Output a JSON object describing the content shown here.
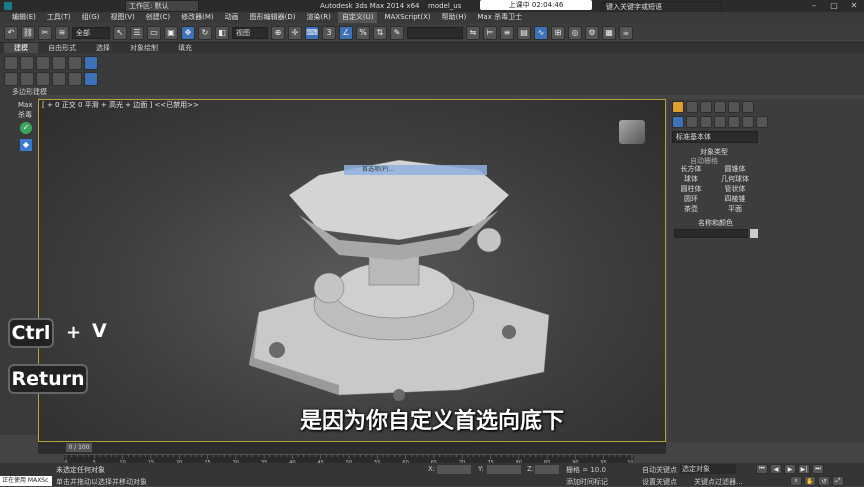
{
  "titlebar": {
    "workspace": "工作区: 默认",
    "title": "Autodesk 3ds Max  2014 x64",
    "file": "model_us",
    "search_placeholder": "键入关键字或短语",
    "controls": [
      "–",
      "▢",
      "✕"
    ]
  },
  "recording": {
    "label": "上课中 02:04:46"
  },
  "menu": [
    "编辑(E)",
    "工具(T)",
    "组(G)",
    "视图(V)",
    "创建(C)",
    "修改器(M)",
    "动画",
    "图形编辑器(D)",
    "渲染(R)",
    "自定义(U)",
    "MAXScript(X)",
    "帮助(H)",
    "Max 杀毒卫士"
  ],
  "toolbar": {
    "selection_set": "全部",
    "view_dropdown": "视图",
    "snap_value": "3",
    "percent_value": "2.5"
  },
  "ribbon_tabs": [
    "建模",
    "自由形式",
    "选择",
    "对象绘制",
    "填充"
  ],
  "ribbon": {
    "poly_label": "多边形建模"
  },
  "left_strip": {
    "max_label": "Max",
    "kill_label": "杀毒"
  },
  "viewport": {
    "label": "[ + 0 正交 0 平滑 + 高光 + 边面 ] <<已禁用>>",
    "quad_menu_text": "首选项(P)..."
  },
  "command_panel": {
    "dropdown": "标准基本体",
    "section_object_type": "对象类型",
    "autogrid": "自动栅格",
    "buttons": [
      "长方体",
      "圆锥体",
      "球体",
      "几何球体",
      "圆柱体",
      "管状体",
      "圆环",
      "四棱锥",
      "茶壶",
      "平面"
    ],
    "section_name_color": "名称和颜色"
  },
  "timeline": {
    "frame": "0 / 100",
    "ticks": [
      "0",
      "5",
      "10",
      "15",
      "20",
      "25",
      "30",
      "35",
      "40",
      "45",
      "50",
      "55",
      "60",
      "65",
      "70",
      "75",
      "80",
      "85",
      "90",
      "95",
      "100"
    ]
  },
  "status": {
    "line1": "未选定任何对象",
    "line2": "单击并拖动以选择并移动对象",
    "left_label": "正在使用 MAXSc",
    "x_label": "X:",
    "y_label": "Y:",
    "z_label": "Z:",
    "grid": "栅格 = 10.0",
    "auto_key": "自动关键点",
    "selected": "选定对象",
    "set_key": "设置关键点",
    "key_filters": "关键点过滤器...",
    "add_time_tag": "添加时间标记"
  },
  "overlay": {
    "key1": "Ctrl",
    "plus": "+",
    "key2": "V",
    "key3": "Return",
    "subtitle": "是因为你自定义首选向底下"
  },
  "colors": {
    "viewport_border": "#b8a23a",
    "accent_blue": "#3c72b8"
  }
}
